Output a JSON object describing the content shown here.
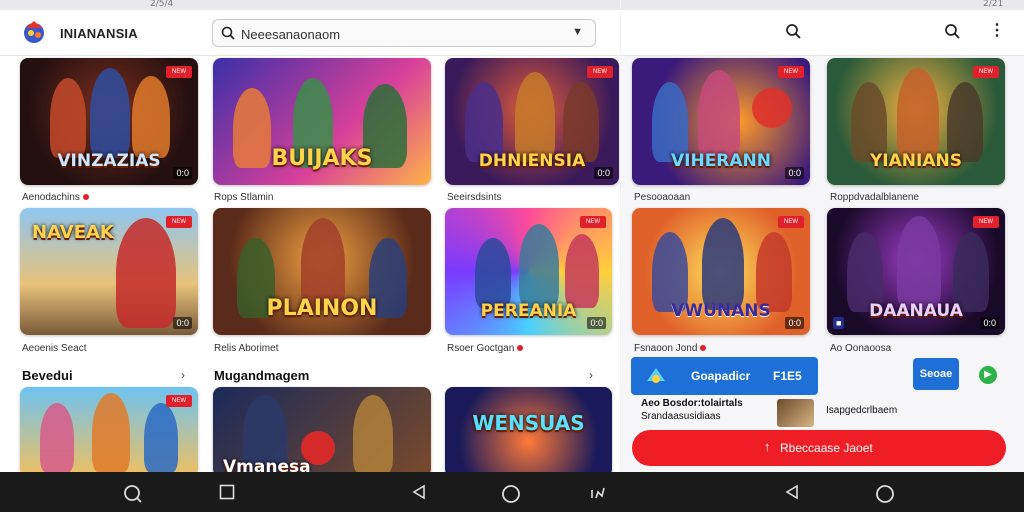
{
  "app": {
    "brand": "INIANANSIA",
    "search_placeholder": "Neeesanaonaom"
  },
  "left_cards": [
    {
      "title": "VINZAZIAS",
      "badge": "NEW",
      "caption": "Aenodachins",
      "corner": "0:0"
    },
    {
      "title": "BUIJAKS",
      "badge": "",
      "caption": "Rops Stlamin",
      "corner": ""
    },
    {
      "title": "DHNIENSIA",
      "badge": "NEW",
      "caption": "Seeirsdsints",
      "corner": "0:0"
    },
    {
      "title": "NAVEAK",
      "badge": "NEW",
      "caption": "Aeoenis Seact",
      "corner": "0:0"
    },
    {
      "title": "PLAINON",
      "badge": "",
      "caption": "Relis Aborimet",
      "corner": ""
    },
    {
      "title": "PEREANIA",
      "badge": "NEW",
      "caption": "Rsoer Goctgan",
      "corner": "0:0"
    }
  ],
  "sections": [
    {
      "title": "Bevedui",
      "chevron": "›"
    },
    {
      "title": "Mugandmagem",
      "chevron": "›"
    }
  ],
  "bottom_cards": [
    {
      "title": "",
      "badge": "NEW"
    },
    {
      "title": "Vmanesa",
      "badge": ""
    },
    {
      "title": "WENSUAS",
      "badge": ""
    }
  ],
  "right_cards": [
    {
      "title": "VIHERANN",
      "badge": "NEW",
      "caption": "Pesooaoaan",
      "corner": "0:0"
    },
    {
      "title": "YIANIANS",
      "badge": "NEW",
      "caption": "Roppdvadalblanene",
      "corner": ""
    },
    {
      "title": "VWUNANS",
      "badge": "NEW",
      "caption": "Fsnaoon Jond",
      "corner": "0:0"
    },
    {
      "title": "DAANAUA",
      "badge": "NEW",
      "caption": "Ao Oonaoosa",
      "corner": "0:0"
    }
  ],
  "promo": {
    "label": "Goapadicr",
    "value": "F1E5"
  },
  "small_button": "Seoae",
  "news_left": "Aeo Bosdor:tolairtals",
  "news_left2": "Srandaasusidiaas",
  "news_right": "Isapgedcrlbaem",
  "cta": {
    "icon": "↑",
    "label": "Rbeccaase Jaoet"
  },
  "statusbar": {
    "left": "2/5/4",
    "right": "2/21"
  },
  "colors": {
    "accent": "#1e6fd6",
    "cta": "#ee1d26",
    "badge": "#e0202b"
  }
}
